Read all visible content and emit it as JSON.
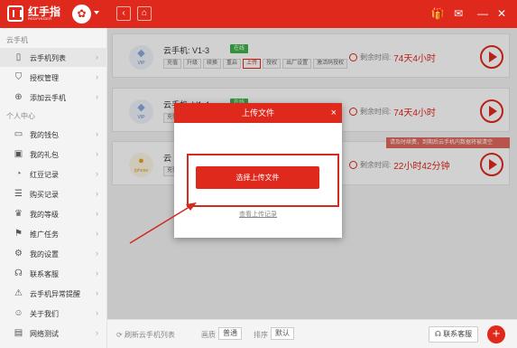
{
  "app": {
    "brand_name": "红手指",
    "brand_sub": "REDFINGER",
    "avatar_glyph": "✿",
    "accent": "#e0291d"
  },
  "titlebar_icons": [
    "back-icon",
    "home-icon",
    "gift-icon",
    "mail-icon",
    "minimize-icon",
    "close-icon"
  ],
  "sidebar": {
    "sections": [
      "云手机",
      "个人中心"
    ],
    "items": [
      {
        "label": "云手机列表",
        "icon": "phone-icon",
        "active": true
      },
      {
        "label": "授权管理",
        "icon": "shield-icon"
      },
      {
        "label": "添加云手机",
        "icon": "plus-circle-icon"
      },
      {
        "label": "我的钱包",
        "icon": "wallet-icon"
      },
      {
        "label": "我的礼包",
        "icon": "gift-icon"
      },
      {
        "label": "红豆记录",
        "icon": "bean-icon"
      },
      {
        "label": "购买记录",
        "icon": "receipt-icon"
      },
      {
        "label": "我的等级",
        "icon": "crown-icon"
      },
      {
        "label": "推广任务",
        "icon": "flag-icon"
      },
      {
        "label": "我的设置",
        "icon": "gear-icon"
      },
      {
        "label": "联系客服",
        "icon": "headset-icon"
      },
      {
        "label": "云手机异常提醒",
        "icon": "warning-icon"
      },
      {
        "label": "关于我们",
        "icon": "smile-icon"
      },
      {
        "label": "网络测试",
        "icon": "document-icon"
      }
    ]
  },
  "cards": [
    {
      "name": "云手机: V1-3",
      "status": "在线",
      "remain_label": "剩余时间:",
      "remain_value": "74天4小时",
      "logo_label": "VIP",
      "tags": [
        "充值",
        "升级",
        "续换",
        "重启",
        "上传",
        "授权",
        "出厂设置",
        "激活码授权"
      ]
    },
    {
      "name": "云手机: V1-4",
      "status": "在线",
      "remain_label": "剩余时间:",
      "remain_value": "74天4小时",
      "logo_label": "VIP",
      "tags": [
        "充值",
        "升级"
      ]
    },
    {
      "name": "云",
      "status": "",
      "remain_label": "剩余时间:",
      "remain_value": "22小时42分钟",
      "logo_label": "Iphone",
      "tags": [
        "充值"
      ]
    }
  ],
  "tip": "请及时续费，到期后云手机内数据将被清空",
  "bottombar": {
    "refresh_label": "刷新云手机列表",
    "view_label": "画质",
    "view_value": "普通",
    "sort_label": "排序",
    "sort_value": "默认",
    "cs_label": "联系客服",
    "add_label": "+"
  },
  "dialog": {
    "title": "上传文件",
    "close": "×",
    "select_button": "选择上传文件",
    "view_link": "查看上传记录"
  }
}
